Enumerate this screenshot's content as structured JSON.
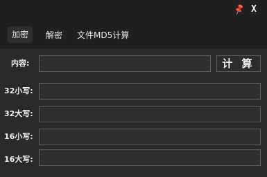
{
  "titlebar": {
    "pin_icon": "pin-icon",
    "close_label": "X"
  },
  "tabs": [
    {
      "label": "加密",
      "active": true
    },
    {
      "label": "解密",
      "active": false
    },
    {
      "label": "文件MD5计算",
      "active": false
    }
  ],
  "form": {
    "content_label": "内容:",
    "content_value": "",
    "calc_button": "计 算",
    "rows": [
      {
        "label": "32小写:",
        "value": ""
      },
      {
        "label": "32大写:",
        "value": ""
      },
      {
        "label": "16小写:",
        "value": ""
      },
      {
        "label": "16大写:",
        "value": ""
      }
    ]
  },
  "colors": {
    "background": "#2a2a2a",
    "header": "#1f1f1f",
    "border": "#5a5a5a",
    "text": "#f0f0f0"
  }
}
